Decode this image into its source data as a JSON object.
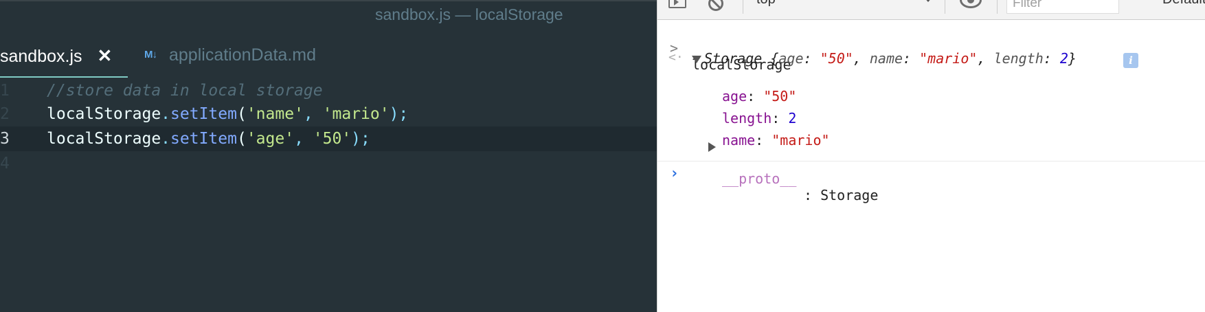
{
  "editor": {
    "window_title": "sandbox.js — localStorage",
    "tabs": [
      {
        "label": "sandbox.js",
        "close_glyph": "✕",
        "active": true
      },
      {
        "label": "applicationData.md",
        "badge": "M↓",
        "active": false
      }
    ],
    "lines": [
      {
        "number": "1",
        "comment": "//store data in local storage"
      },
      {
        "number": "2",
        "object": "localStorage",
        "dot": ".",
        "method": "setItem",
        "open": "(",
        "arg1": "'name'",
        "comma": ", ",
        "arg2": "'mario'",
        "close": ");"
      },
      {
        "number": "3",
        "object": "localStorage",
        "dot": ".",
        "method": "setItem",
        "open": "(",
        "arg1": "'age'",
        "comma": ", ",
        "arg2": "'50'",
        "close": ");"
      },
      {
        "number": "4"
      }
    ],
    "colors": {
      "background": "#263238",
      "active_tab_underline": "#80cbc4"
    }
  },
  "devtools": {
    "toolbar": {
      "context": "top",
      "filter_placeholder": "Filter",
      "levels": "Default levels"
    },
    "console": {
      "input_chevron": ">",
      "input": "localStorage",
      "result_arrow": "<·",
      "preview": {
        "type": "Storage",
        "open": " {",
        "k1": "age",
        "v1": "\"50\"",
        "k2": "name",
        "v2": "\"mario\"",
        "k3": "length",
        "v3": "2",
        "close": "}"
      },
      "info_badge": "i",
      "properties": [
        {
          "key": "age",
          "value": "\"50\""
        },
        {
          "key": "length",
          "value": "2"
        },
        {
          "key": "name",
          "value": "\"mario\""
        }
      ],
      "proto": {
        "key": "__proto__",
        "value": "Storage"
      },
      "prompt": "›"
    }
  }
}
